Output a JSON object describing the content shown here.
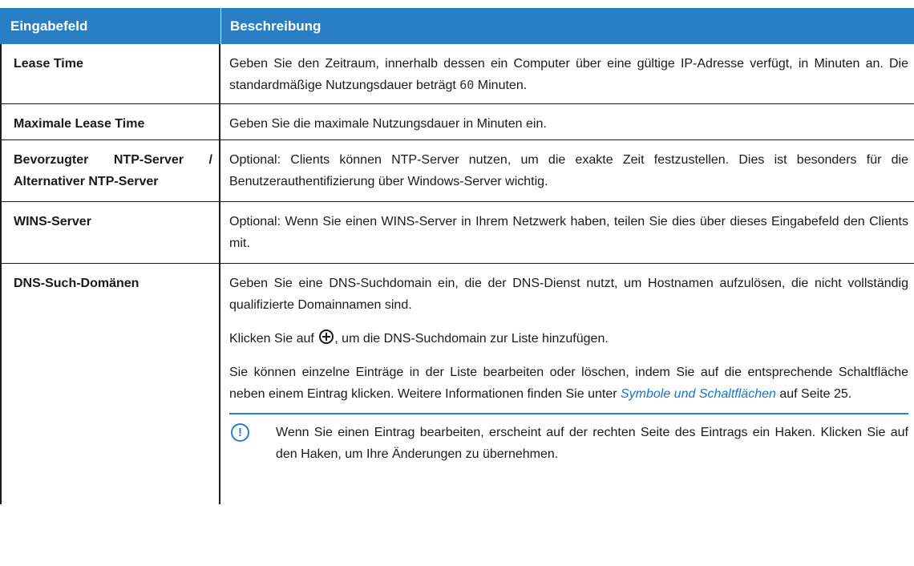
{
  "header": {
    "col1": "Eingabefeld",
    "col2": "Beschreibung"
  },
  "rows": [
    {
      "field": "Lease Time",
      "desc_pre": "Geben Sie den Zeitraum, innerhalb dessen ein Computer über eine gültige IP-Adresse verfügt, in Minuten an. Die standardmäßige Nutzungsdauer beträgt ",
      "desc_code": "60",
      "desc_post": " Minuten."
    },
    {
      "field": "Maximale Lease Time",
      "desc": "Geben Sie die maximale Nutzungsdauer in Minuten ein."
    },
    {
      "field_line1": "Bevorzugter NTP-Server /",
      "field_line2": "Alternativer NTP-Server",
      "desc": "Optional: Clients können NTP-Server nutzen, um die exakte Zeit festzustellen. Dies ist besonders für die Benutzerauthentifizierung über Windows-Server wichtig."
    },
    {
      "field": "WINS-Server",
      "desc": "Optional: Wenn Sie einen WINS-Server in Ihrem Netzwerk haben, teilen Sie dies über dieses Eingabefeld den Clients mit."
    },
    {
      "field": "DNS-Such-Domänen",
      "p1": "Geben Sie eine DNS-Suchdomain ein, die der DNS-Dienst nutzt, um Hostnamen aufzulösen, die nicht vollständig qualifizierte Domainnamen sind.",
      "p2_pre": "Klicken Sie auf ",
      "p2_icon": "plus-circle-icon",
      "p2_post": ", um die DNS-Suchdomain zur Liste hinzufügen.",
      "p3_pre": "Sie können einzelne Einträge in der Liste bearbeiten oder löschen, indem Sie auf die entsprechende Schaltfläche neben einem Eintrag klicken. Weitere Informationen finden Sie unter ",
      "p3_link": "Symbole und Schaltflächen",
      "p3_post": " auf Seite 25.",
      "note_icon": "info-exclamation-icon",
      "note": "Wenn Sie einen Eintrag bearbeiten, erscheint auf der rechten Seite des Eintrags ein Haken. Klicken Sie auf den Haken, um Ihre Änderungen zu übernehmen."
    }
  ],
  "colors": {
    "header_bg": "#2a7fc4",
    "link": "#1a73c7",
    "note_accent": "#2a7fc4"
  }
}
